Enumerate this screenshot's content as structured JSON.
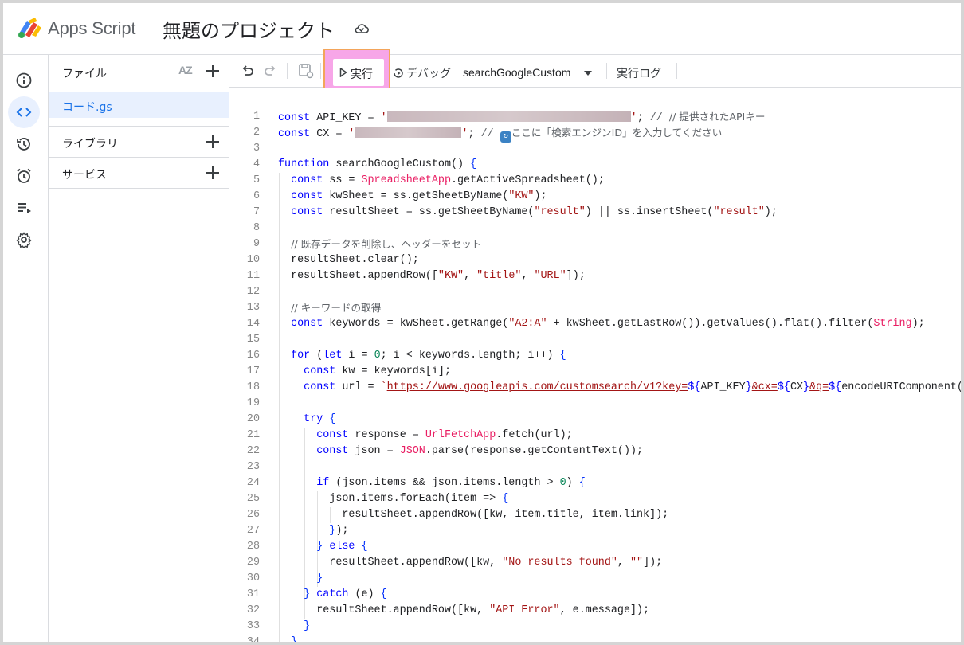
{
  "header": {
    "brand": "Apps Script",
    "project_title": "無題のプロジェクト"
  },
  "rail": {
    "items": [
      {
        "icon": "info-icon"
      },
      {
        "icon": "code-icon",
        "active": true
      },
      {
        "icon": "history-icon"
      },
      {
        "icon": "alarm-icon"
      },
      {
        "icon": "executions-icon"
      },
      {
        "icon": "settings-icon"
      }
    ]
  },
  "files_panel": {
    "title": "ファイル",
    "sort_label": "AZ",
    "files": [
      {
        "name": "コード.gs"
      }
    ],
    "libraries_label": "ライブラリ",
    "services_label": "サービス"
  },
  "toolbar": {
    "run_label": "実行",
    "debug_label": "デバッグ",
    "function_name": "searchGoogleCustom",
    "log_label": "実行ログ"
  },
  "code": {
    "line_numbers": [
      "1",
      "2",
      "3",
      "4",
      "5",
      "6",
      "7",
      "8",
      "9",
      "10",
      "11",
      "12",
      "13",
      "14",
      "15",
      "16",
      "17",
      "18",
      "19",
      "20",
      "21",
      "22",
      "23",
      "24",
      "25",
      "26",
      "27",
      "28",
      "29",
      "30",
      "31",
      "32",
      "33",
      "34"
    ],
    "line1_comment": "// 提供されたAPIキー",
    "line2_comment_a": "//",
    "line2_comment_b": "ここに「検索エンジンID」を入力してください",
    "line9_comment": "// 既存データを削除し、ヘッダーをセット",
    "line13_comment": "// キーワードの取得"
  },
  "colors": {
    "keyword": "#0000ff",
    "string": "#a31515",
    "number": "#098658",
    "class": "#e91e63",
    "active_bg": "#e8f0fe",
    "accent": "#1a73e8",
    "highlight": "#f7a6e8"
  }
}
